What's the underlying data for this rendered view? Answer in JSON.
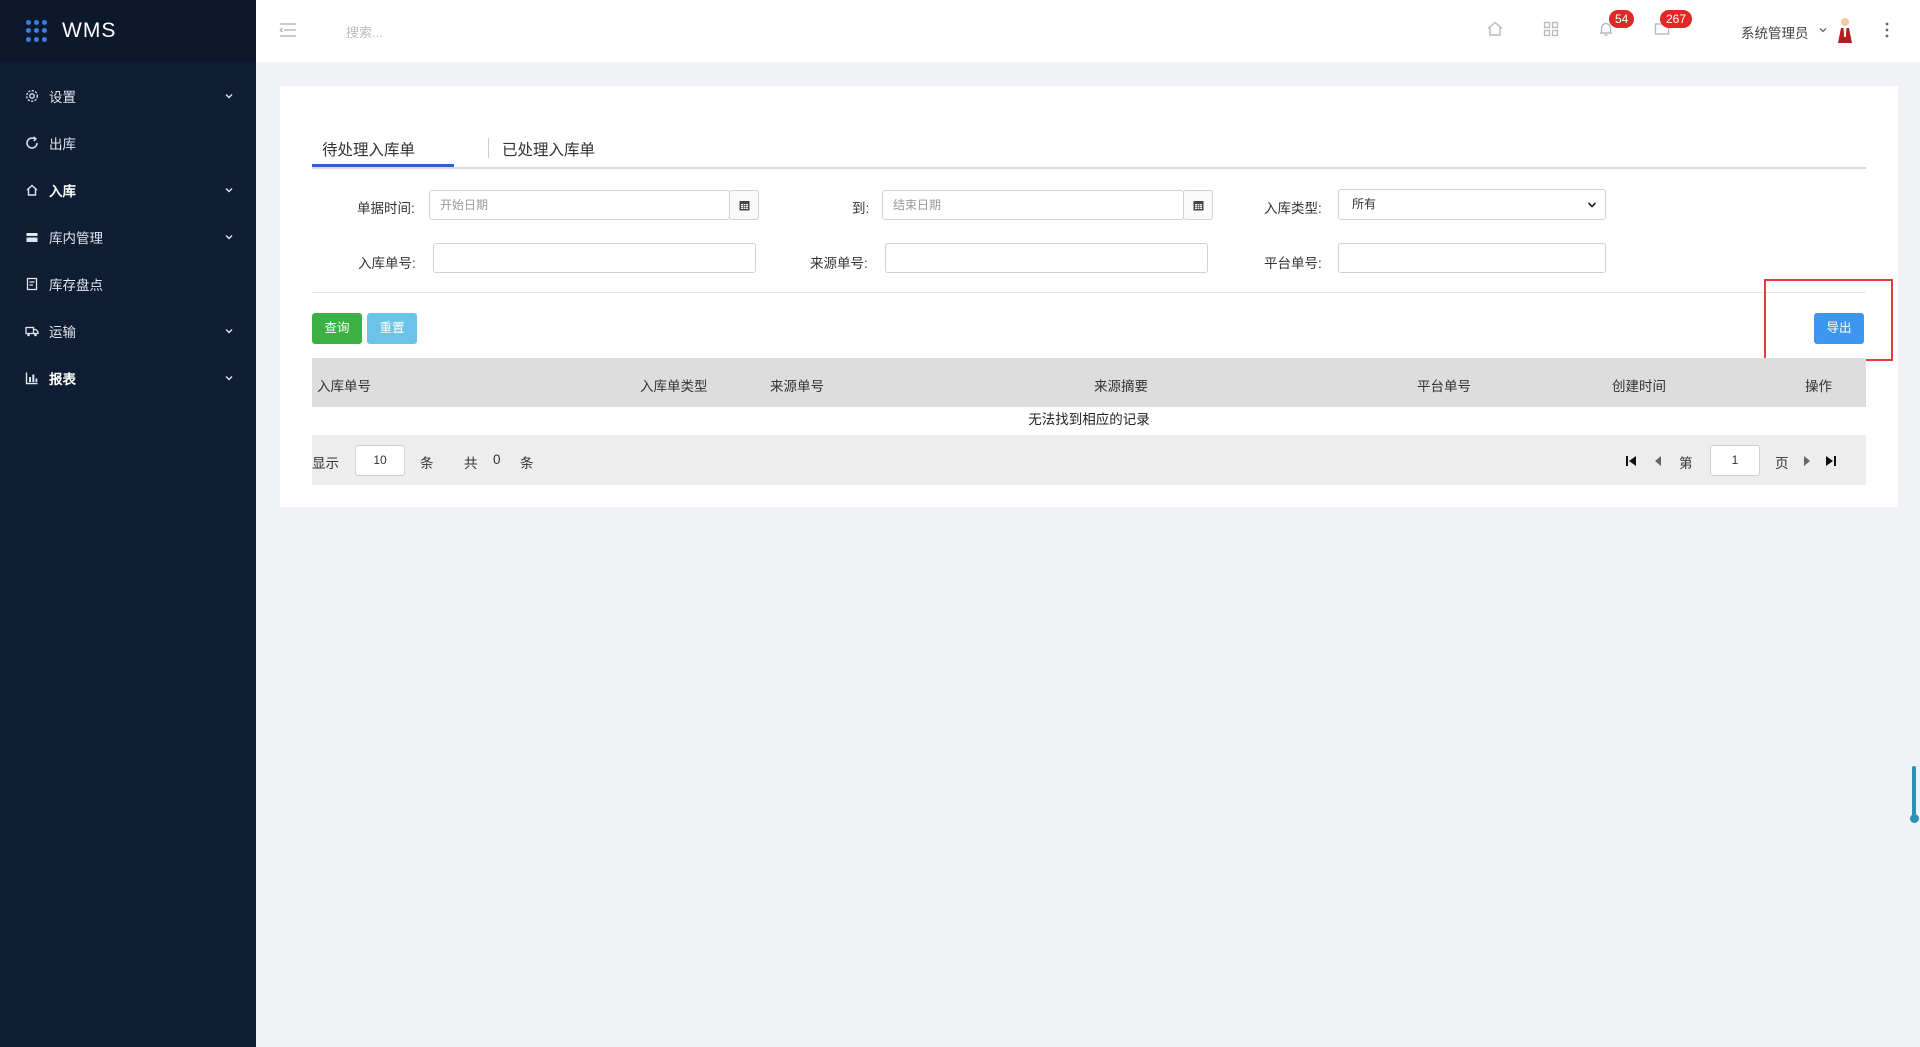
{
  "brand": {
    "title": "WMS",
    "accent": "#3d7be0"
  },
  "sidebar": {
    "items": [
      {
        "label": "设置",
        "icon": "gear-icon",
        "expandable": true
      },
      {
        "label": "出库",
        "icon": "outbound-icon",
        "expandable": false
      },
      {
        "label": "入库",
        "icon": "inbound-icon",
        "expandable": true,
        "active": true
      },
      {
        "label": "库内管理",
        "icon": "warehouse-icon",
        "expandable": true
      },
      {
        "label": "库存盘点",
        "icon": "inventory-icon",
        "expandable": false
      },
      {
        "label": "运输",
        "icon": "truck-icon",
        "expandable": true
      },
      {
        "label": "报表",
        "icon": "chart-icon",
        "expandable": true
      }
    ]
  },
  "header": {
    "search_placeholder": "搜索...",
    "notifications_badge": "54",
    "messages_badge": "267",
    "user_name": "系统管理员",
    "badge_color": "#e22727"
  },
  "tabs": [
    {
      "label": "待处理入库单",
      "active": true
    },
    {
      "label": "已处理入库单",
      "active": false
    }
  ],
  "filters": {
    "date_label": "单据时间:",
    "start_placeholder": "开始日期",
    "to_label": "到:",
    "end_placeholder": "结束日期",
    "type_label": "入库类型:",
    "type_value": "所有",
    "order_no_label": "入库单号:",
    "source_no_label": "来源单号:",
    "platform_no_label": "平台单号:"
  },
  "buttons": {
    "query": "查询",
    "reset": "重置",
    "export": "导出",
    "query_color": "#3cb043",
    "reset_color": "#6cc3e8",
    "export_color": "#3d96f0"
  },
  "table": {
    "columns": [
      "入库单号",
      "入库单类型",
      "来源单号",
      "来源摘要",
      "平台单号",
      "创建时间",
      "操作"
    ],
    "empty_text": "无法找到相应的记录"
  },
  "pagination": {
    "show_label": "显示",
    "page_size": "10",
    "unit": "条",
    "total_label": "共",
    "total": "0",
    "total_unit": "条",
    "page_prefix": "第",
    "page": "1",
    "page_suffix": "页"
  }
}
